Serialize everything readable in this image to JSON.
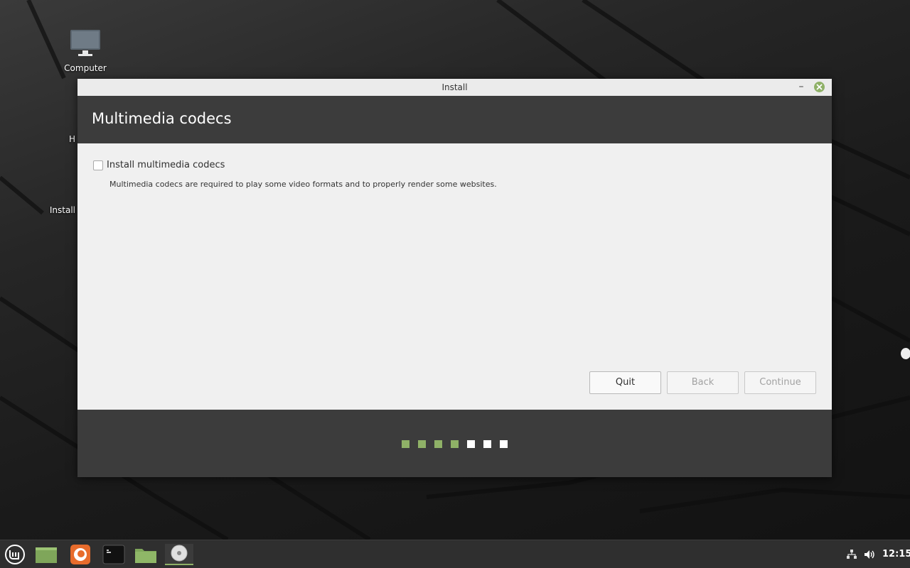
{
  "desktop": {
    "icons": [
      {
        "label": "Computer"
      },
      {
        "label": "H"
      },
      {
        "label": "Install"
      }
    ]
  },
  "window": {
    "title": "Install",
    "minimize_glyph": "–",
    "header_title": "Multimedia codecs",
    "option": {
      "label": "Install multimedia codecs",
      "checked": false,
      "description": "Multimedia codecs are required to play some video formats and to properly render some websites."
    },
    "buttons": {
      "quit": "Quit",
      "back": "Back",
      "continue": "Continue"
    },
    "progress": {
      "steps_total": 7,
      "steps_done": 4
    },
    "colors": {
      "accent": "#8fb167",
      "header_bg": "#3c3c3c",
      "content_bg": "#f0f0f0"
    }
  },
  "panel": {
    "launchers": [
      "menu-icon",
      "show-desktop-icon",
      "firefox-icon",
      "terminal-icon",
      "files-icon",
      "installer-disc-icon"
    ],
    "clock": "12:15"
  }
}
